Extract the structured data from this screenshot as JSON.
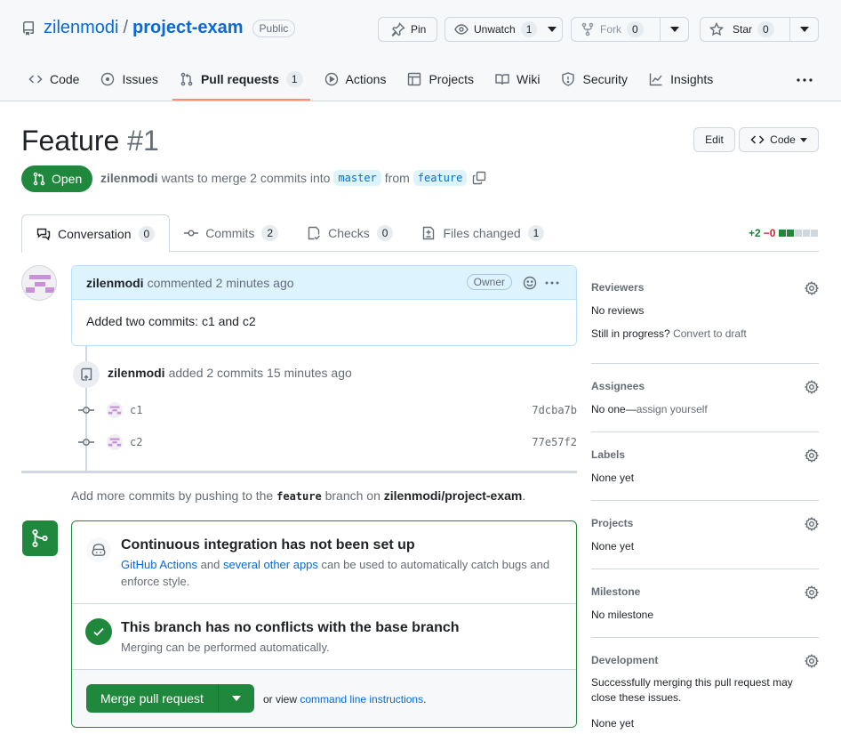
{
  "repo": {
    "owner": "zilenmodi",
    "separator": "/",
    "name": "project-exam",
    "visibility": "Public"
  },
  "header_buttons": {
    "pin": "Pin",
    "unwatch": "Unwatch",
    "unwatch_count": "1",
    "fork": "Fork",
    "fork_count": "0",
    "star": "Star",
    "star_count": "0"
  },
  "nav_tabs": [
    {
      "label": "Code",
      "icon": "code-icon"
    },
    {
      "label": "Issues",
      "icon": "issue-icon"
    },
    {
      "label": "Pull requests",
      "icon": "pull-request-icon",
      "count": "1",
      "active": true
    },
    {
      "label": "Actions",
      "icon": "play-icon"
    },
    {
      "label": "Projects",
      "icon": "table-icon"
    },
    {
      "label": "Wiki",
      "icon": "book-icon"
    },
    {
      "label": "Security",
      "icon": "shield-icon"
    },
    {
      "label": "Insights",
      "icon": "graph-icon"
    }
  ],
  "pr": {
    "title": "Feature",
    "number": "#1",
    "state": "Open",
    "author": "zilenmodi",
    "merge_text": "wants to merge 2 commits into",
    "base_branch": "master",
    "from_text": "from",
    "head_branch": "feature",
    "edit_label": "Edit",
    "code_label": "Code"
  },
  "pr_tabs": [
    {
      "label": "Conversation",
      "count": "0",
      "active": true
    },
    {
      "label": "Commits",
      "count": "2"
    },
    {
      "label": "Checks",
      "count": "0"
    },
    {
      "label": "Files changed",
      "count": "1"
    }
  ],
  "diffstat": {
    "additions": "+2",
    "deletions": "−0"
  },
  "comment": {
    "author": "zilenmodi",
    "action": "commented 2 minutes ago",
    "badge": "Owner",
    "body": "Added two commits: c1 and c2"
  },
  "commits_event": {
    "author": "zilenmodi",
    "text": "added 2 commits 15 minutes ago",
    "commits": [
      {
        "message": "c1",
        "sha": "7dcba7b"
      },
      {
        "message": "c2",
        "sha": "77e57f2"
      }
    ]
  },
  "push_hint": {
    "prefix": "Add more commits by pushing to the",
    "branch": "feature",
    "middle": "branch on",
    "repo": "zilenmodi/project-exam",
    "suffix": "."
  },
  "merge_box": {
    "ci_title": "Continuous integration has not been set up",
    "ci_link1": "GitHub Actions",
    "ci_and": "and",
    "ci_link2": "several other apps",
    "ci_rest": "can be used to automatically catch bugs and enforce style.",
    "conflict_title": "This branch has no conflicts with the base branch",
    "conflict_sub": "Merging can be performed automatically.",
    "merge_button": "Merge pull request",
    "or_view": "or view",
    "cli_link": "command line instructions",
    "cli_suffix": "."
  },
  "sidebar": {
    "reviewers": {
      "title": "Reviewers",
      "line1": "No reviews",
      "line2_prefix": "Still in progress?",
      "line2_link": "Convert to draft"
    },
    "assignees": {
      "title": "Assignees",
      "prefix": "No one—",
      "link": "assign yourself"
    },
    "labels": {
      "title": "Labels",
      "value": "None yet"
    },
    "projects": {
      "title": "Projects",
      "value": "None yet"
    },
    "milestone": {
      "title": "Milestone",
      "value": "No milestone"
    },
    "development": {
      "title": "Development",
      "text": "Successfully merging this pull request may close these issues.",
      "value": "None yet"
    }
  },
  "colors": {
    "accent": "#0969da",
    "success": "#1f883d",
    "danger": "#cf222e",
    "tab_underline": "#fd8c73"
  }
}
